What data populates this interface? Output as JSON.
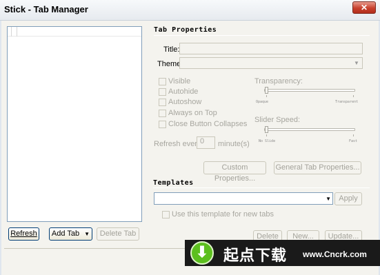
{
  "window": {
    "title": "Stick - Tab Manager",
    "close_glyph": "✕"
  },
  "left_panel": {
    "refresh_label": "Refresh",
    "add_tab_label": "Add Tab",
    "add_tab_arrow": "▼",
    "delete_tab_label": "Delete Tab"
  },
  "tab_properties": {
    "heading": "Tab Properties",
    "title_label": "Title:",
    "title_value": "",
    "theme_label": "Theme:",
    "theme_value": "",
    "checkboxes": [
      {
        "label": "Visible",
        "checked": false
      },
      {
        "label": "Autohide",
        "checked": false
      },
      {
        "label": "Autoshow",
        "checked": false
      },
      {
        "label": "Always on Top",
        "checked": false
      },
      {
        "label": "Close Button Collapses",
        "checked": false
      }
    ],
    "transparency_label": "Transparency:",
    "transparency_min": "Opaque",
    "transparency_max": "Transparent",
    "transparency_value": 0,
    "slider_speed_label": "Slider Speed:",
    "speed_min": "No Slide",
    "speed_max": "Fast",
    "speed_value": 0,
    "refresh_every_label": "Refresh every",
    "refresh_every_value": "0",
    "minutes_label": "minute(s)",
    "custom_properties_label": "Custom Properties...",
    "general_tab_properties_label": "General Tab Properties..."
  },
  "templates": {
    "heading": "Templates",
    "selected": "",
    "apply_label": "Apply",
    "use_template_label": "Use this template for new tabs",
    "delete_label": "Delete",
    "new_label": "New...",
    "update_label": "Update..."
  },
  "watermark": {
    "text": "起点下载",
    "url": "www.Cncrk.com",
    "icon": "download-arrow-icon",
    "colors": {
      "icon_green": "#5cbf1e",
      "background": "#1a1a1a"
    }
  },
  "colors": {
    "dialog_bg": "#f4f3ee",
    "disabled_text": "#a7a69f",
    "close_red": "#c8402d"
  }
}
